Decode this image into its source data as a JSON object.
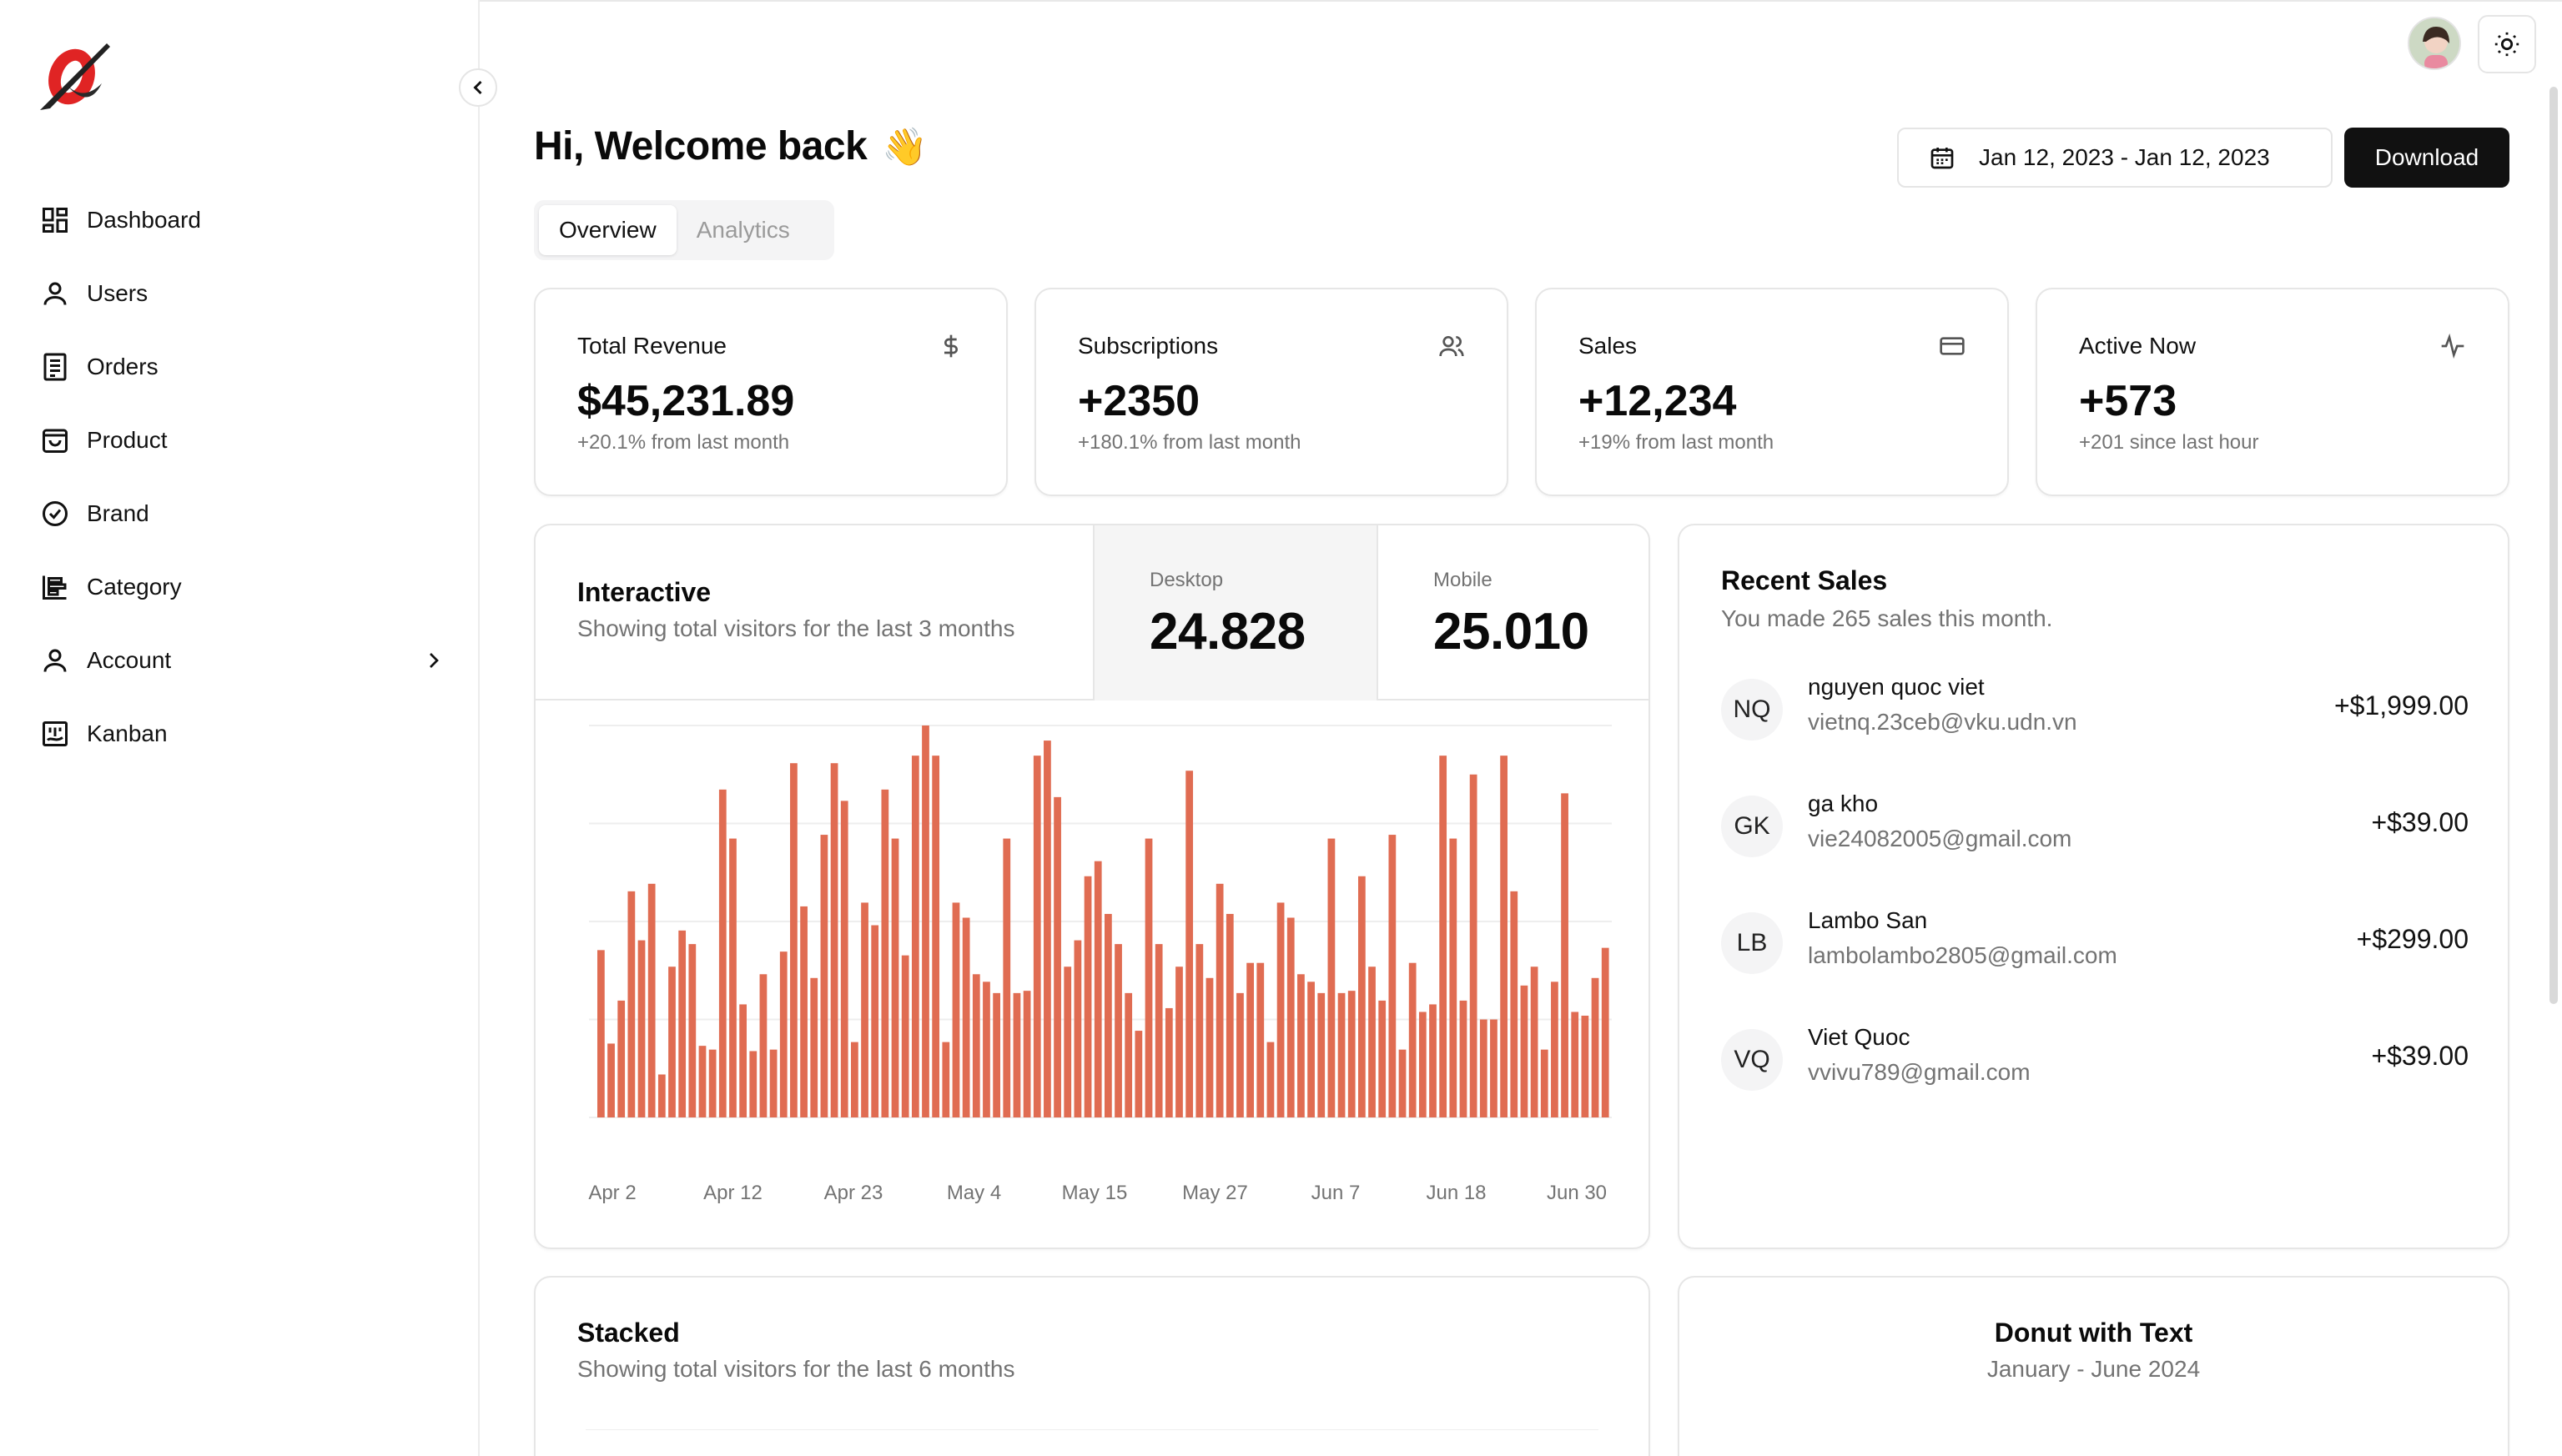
{
  "sidebar": {
    "items": [
      {
        "label": "Dashboard",
        "icon": "dashboard-icon"
      },
      {
        "label": "Users",
        "icon": "user-icon"
      },
      {
        "label": "Orders",
        "icon": "orders-icon"
      },
      {
        "label": "Product",
        "icon": "product-bag-icon"
      },
      {
        "label": "Brand",
        "icon": "brand-badge-icon"
      },
      {
        "label": "Category",
        "icon": "category-icon"
      },
      {
        "label": "Account",
        "icon": "account-icon",
        "has_submenu": true
      },
      {
        "label": "Kanban",
        "icon": "kanban-icon"
      }
    ]
  },
  "header": {
    "greeting": "Hi, Welcome back",
    "greeting_emoji": "👋",
    "date_range": "Jan 12, 2023 - Jan 12, 2023",
    "download_label": "Download",
    "tabs": [
      {
        "label": "Overview",
        "active": true
      },
      {
        "label": "Analytics",
        "active": false
      }
    ]
  },
  "stats": [
    {
      "label": "Total Revenue",
      "value": "$45,231.89",
      "sub": "+20.1% from last month",
      "icon": "dollar-icon"
    },
    {
      "label": "Subscriptions",
      "value": "+2350",
      "sub": "+180.1% from last month",
      "icon": "users-icon"
    },
    {
      "label": "Sales",
      "value": "+12,234",
      "sub": "+19% from last month",
      "icon": "credit-card-icon"
    },
    {
      "label": "Active Now",
      "value": "+573",
      "sub": "+201 since last hour",
      "icon": "activity-icon"
    }
  ],
  "interactive": {
    "title": "Interactive",
    "subtitle": "Showing total visitors for the last 3 months",
    "desktop_label": "Desktop",
    "desktop_value": "24.828",
    "mobile_label": "Mobile",
    "mobile_value": "25.010"
  },
  "recent_sales": {
    "title": "Recent Sales",
    "subtitle": "You made 265 sales this month.",
    "items": [
      {
        "initials": "NQ",
        "name": "nguyen quoc viet",
        "email": "vietnq.23ceb@vku.udn.vn",
        "amount": "+$1,999.00"
      },
      {
        "initials": "GK",
        "name": "ga kho",
        "email": "vie24082005@gmail.com",
        "amount": "+$39.00"
      },
      {
        "initials": "LB",
        "name": "Lambo San",
        "email": "lambolambo2805@gmail.com",
        "amount": "+$299.00"
      },
      {
        "initials": "VQ",
        "name": "Viet Quoc",
        "email": "vvivu789@gmail.com",
        "amount": "+$39.00"
      }
    ]
  },
  "stacked": {
    "title": "Stacked",
    "subtitle": "Showing total visitors for the last 6 months"
  },
  "donut": {
    "title": "Donut with Text",
    "subtitle": "January - June 2024"
  },
  "colors": {
    "bar": "#e06c52",
    "accent_dark": "#111111",
    "muted": "#737373"
  },
  "chart_data": {
    "type": "bar",
    "x_tick_labels": [
      "Apr 2",
      "Apr 12",
      "Apr 23",
      "May 4",
      "May 15",
      "May 27",
      "Jun 7",
      "Jun 18",
      "Jun 30"
    ],
    "values": [
      222,
      98,
      155,
      300,
      235,
      310,
      57,
      200,
      248,
      230,
      95,
      90,
      435,
      370,
      150,
      88,
      190,
      90,
      220,
      470,
      280,
      185,
      375,
      470,
      420,
      100,
      285,
      255,
      435,
      370,
      215,
      480,
      520,
      480,
      100,
      285,
      265,
      190,
      180,
      165,
      370,
      165,
      168,
      480,
      500,
      425,
      200,
      235,
      320,
      340,
      270,
      230,
      165,
      115,
      370,
      230,
      145,
      200,
      460,
      230,
      185,
      310,
      270,
      165,
      205,
      205,
      100,
      285,
      265,
      190,
      180,
      165,
      370,
      165,
      168,
      320,
      200,
      155,
      375,
      90,
      205,
      140,
      150,
      480,
      370,
      155,
      455,
      130,
      130,
      480,
      300,
      175,
      200,
      90,
      180,
      430,
      140,
      135,
      185,
      225
    ],
    "x_range": [
      "Apr 2",
      "Jun 30"
    ],
    "grid": "horizontal",
    "legend": "none"
  }
}
